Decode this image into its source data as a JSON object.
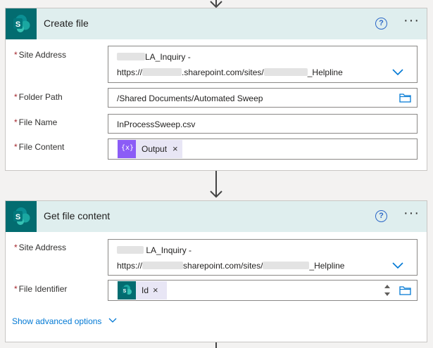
{
  "card1": {
    "title": "Create file",
    "help_icon": "question-circle-icon",
    "menu_icon": "more-ellipsis-icon",
    "fields": {
      "site_address": {
        "label": "Site Address",
        "line1_suffix": "LA_Inquiry -",
        "line2_prefix": "https://",
        "line2_mid": ".sharepoint.com/sites/",
        "line2_suffix": "_Helpline"
      },
      "folder_path": {
        "label": "Folder Path",
        "value": "/Shared Documents/Automated Sweep"
      },
      "file_name": {
        "label": "File Name",
        "value": "InProcessSweep.csv"
      },
      "file_content": {
        "label": "File Content",
        "token_label": "Output",
        "token_remove": "×",
        "token_icon": "variable-icon"
      }
    }
  },
  "card2": {
    "title": "Get file content",
    "help_icon": "question-circle-icon",
    "menu_icon": "more-ellipsis-icon",
    "fields": {
      "site_address": {
        "label": "Site Address",
        "line1_suffix": "LA_Inquiry -",
        "line2_prefix": "https://",
        "line2_mid": "sharepoint.com/sites/",
        "line2_suffix": "_Helpline"
      },
      "file_identifier": {
        "label": "File Identifier",
        "token_label": "Id",
        "token_remove": "×",
        "token_icon": "sharepoint-icon"
      }
    },
    "advanced_label": "Show advanced options"
  },
  "required_marker": "*",
  "colors": {
    "sharepoint": "#036c70",
    "header_bg": "#dfeeee",
    "accent": "#0078d4",
    "required": "#a4262c",
    "variable": "#8b5cf6"
  }
}
